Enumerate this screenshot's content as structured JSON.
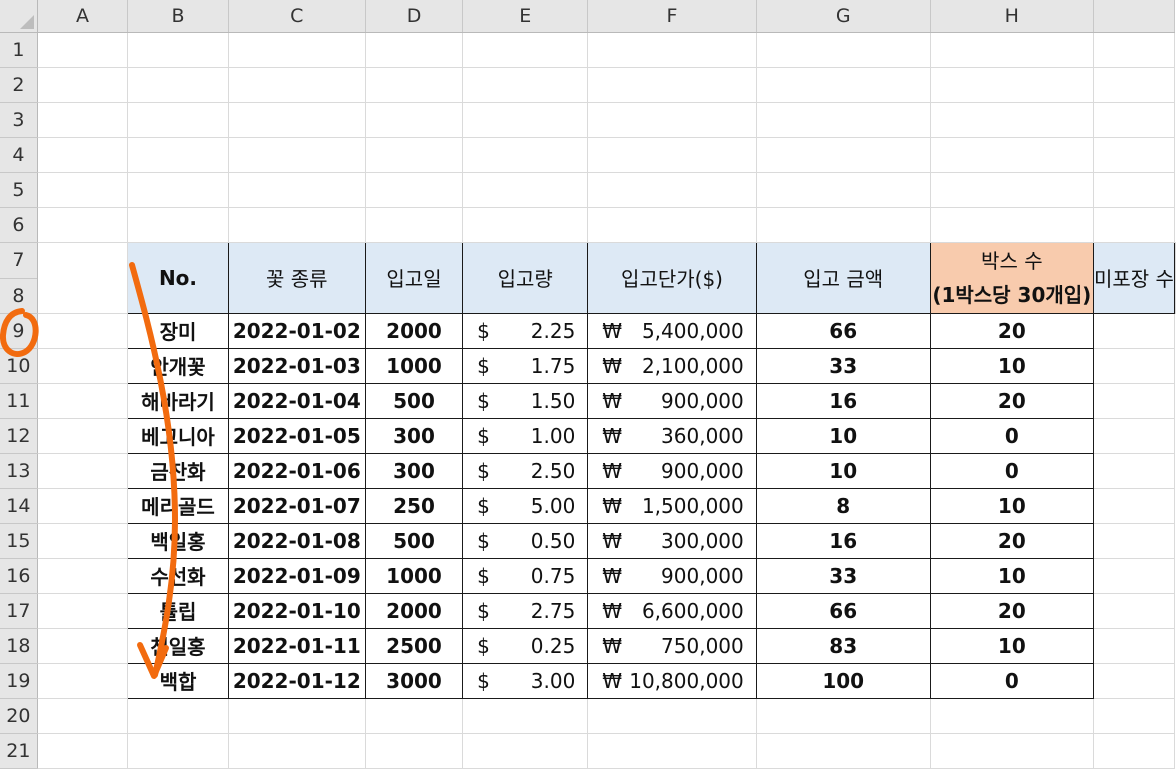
{
  "sheet": {
    "columns": [
      "A",
      "B",
      "C",
      "D",
      "E",
      "F",
      "G",
      "H"
    ],
    "rows": [
      "1",
      "2",
      "3",
      "4",
      "5",
      "6",
      "7",
      "8",
      "9",
      "10",
      "11",
      "12",
      "13",
      "14",
      "15",
      "16",
      "17",
      "18",
      "19",
      "20",
      "21"
    ]
  },
  "table": {
    "headers": {
      "no": "No.",
      "flower_type": "꽃 종류",
      "date": "입고일",
      "quantity": "입고량",
      "unit_price": "입고단가($)",
      "amount": "입고 금액",
      "boxes_line1": "박스 수",
      "boxes_line2": "(1박스당 30개입)",
      "unpacked": "미포장 수"
    },
    "currency_usd": "$",
    "currency_krw": "₩",
    "rows": [
      {
        "no": "",
        "flower": "장미",
        "date": "2022-01-02",
        "qty": "2000",
        "price": "2.25",
        "amount": "5,400,000",
        "boxes": "66",
        "unpacked": "20"
      },
      {
        "no": "",
        "flower": "안개꽃",
        "date": "2022-01-03",
        "qty": "1000",
        "price": "1.75",
        "amount": "2,100,000",
        "boxes": "33",
        "unpacked": "10"
      },
      {
        "no": "",
        "flower": "해바라기",
        "date": "2022-01-04",
        "qty": "500",
        "price": "1.50",
        "amount": "900,000",
        "boxes": "16",
        "unpacked": "20"
      },
      {
        "no": "",
        "flower": "베고니아",
        "date": "2022-01-05",
        "qty": "300",
        "price": "1.00",
        "amount": "360,000",
        "boxes": "10",
        "unpacked": "0"
      },
      {
        "no": "",
        "flower": "금잔화",
        "date": "2022-01-06",
        "qty": "300",
        "price": "2.50",
        "amount": "900,000",
        "boxes": "10",
        "unpacked": "0"
      },
      {
        "no": "",
        "flower": "메리골드",
        "date": "2022-01-07",
        "qty": "250",
        "price": "5.00",
        "amount": "1,500,000",
        "boxes": "8",
        "unpacked": "10"
      },
      {
        "no": "",
        "flower": "백일홍",
        "date": "2022-01-08",
        "qty": "500",
        "price": "0.50",
        "amount": "300,000",
        "boxes": "16",
        "unpacked": "20"
      },
      {
        "no": "",
        "flower": "수선화",
        "date": "2022-01-09",
        "qty": "1000",
        "price": "0.75",
        "amount": "900,000",
        "boxes": "33",
        "unpacked": "10"
      },
      {
        "no": "",
        "flower": "튤립",
        "date": "2022-01-10",
        "qty": "2000",
        "price": "2.75",
        "amount": "6,600,000",
        "boxes": "66",
        "unpacked": "20"
      },
      {
        "no": "",
        "flower": "천일홍",
        "date": "2022-01-11",
        "qty": "2500",
        "price": "0.25",
        "amount": "750,000",
        "boxes": "83",
        "unpacked": "10"
      },
      {
        "no": "",
        "flower": "백합",
        "date": "2022-01-12",
        "qty": "3000",
        "price": "3.00",
        "amount": "10,800,000",
        "boxes": "100",
        "unpacked": "0"
      }
    ]
  },
  "colors": {
    "header_fill": "#dde9f5",
    "boxes_header_fill": "#f8cbad",
    "annotation": "#f26b0f",
    "grid_line": "#dadada",
    "heading_fill": "#e6e6e6"
  },
  "annotations": {
    "row9_circle": "circle-marker",
    "arrow": "down-arrow"
  }
}
